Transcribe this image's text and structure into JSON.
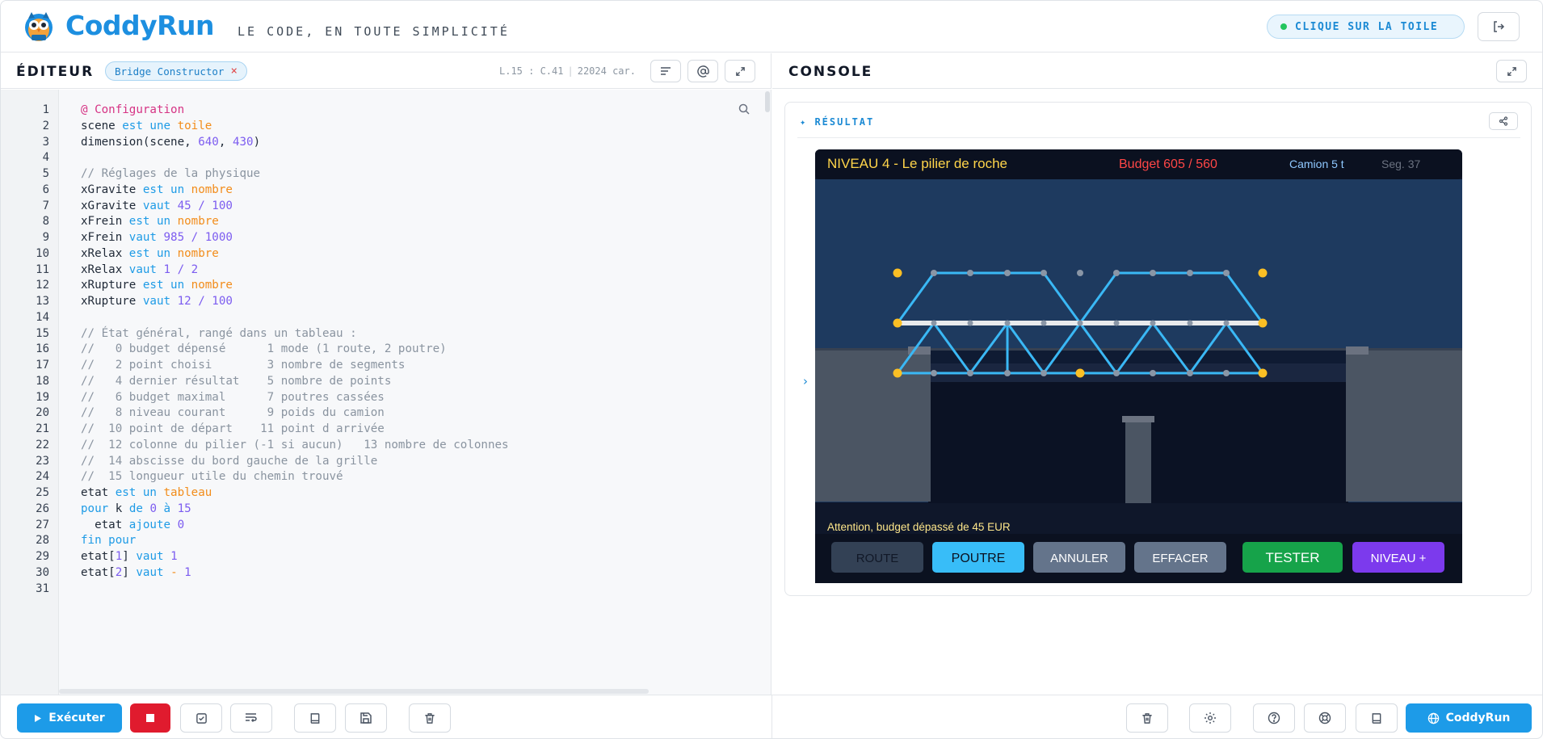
{
  "header": {
    "brand": "CoddyRun",
    "tagline": "LE CODE, EN TOUTE SIMPLICITÉ",
    "status_pill": "CLIQUE SUR LA TOILE",
    "colors": {
      "brand": "#1d8fe0",
      "accent": "#1d9be8",
      "status_dot": "#22c55e"
    }
  },
  "editor": {
    "title": "ÉDITEUR",
    "file_tag": "Bridge Constructor",
    "file_tag_close": "×",
    "cursor_pos": "L.15 : C.41",
    "char_count": "22024 car.",
    "lines": [
      {
        "n": "1",
        "t": [
          [
            "@ Configuration",
            "at"
          ]
        ]
      },
      {
        "n": "2",
        "t": [
          [
            "scene ",
            ""
          ],
          [
            "est une ",
            "kw"
          ],
          [
            "toile",
            "ty"
          ]
        ]
      },
      {
        "n": "3",
        "t": [
          [
            "dimension(scene, ",
            ""
          ],
          [
            "640",
            "num"
          ],
          [
            ", ",
            ""
          ],
          [
            "430",
            "num"
          ],
          [
            ")",
            ""
          ]
        ]
      },
      {
        "n": "4",
        "t": []
      },
      {
        "n": "5",
        "t": [
          [
            "// Réglages de la physique",
            "cm"
          ]
        ]
      },
      {
        "n": "6",
        "t": [
          [
            "xGravite ",
            ""
          ],
          [
            "est un ",
            "kw"
          ],
          [
            "nombre",
            "ty"
          ]
        ]
      },
      {
        "n": "7",
        "t": [
          [
            "xGravite ",
            ""
          ],
          [
            "vaut ",
            "kw"
          ],
          [
            "45 / 100",
            "num"
          ]
        ]
      },
      {
        "n": "8",
        "t": [
          [
            "xFrein ",
            ""
          ],
          [
            "est un ",
            "kw"
          ],
          [
            "nombre",
            "ty"
          ]
        ]
      },
      {
        "n": "9",
        "t": [
          [
            "xFrein ",
            ""
          ],
          [
            "vaut ",
            "kw"
          ],
          [
            "985 / 1000",
            "num"
          ]
        ]
      },
      {
        "n": "10",
        "t": [
          [
            "xRelax ",
            ""
          ],
          [
            "est un ",
            "kw"
          ],
          [
            "nombre",
            "ty"
          ]
        ]
      },
      {
        "n": "11",
        "t": [
          [
            "xRelax ",
            ""
          ],
          [
            "vaut ",
            "kw"
          ],
          [
            "1 / 2",
            "num"
          ]
        ]
      },
      {
        "n": "12",
        "t": [
          [
            "xRupture ",
            ""
          ],
          [
            "est un ",
            "kw"
          ],
          [
            "nombre",
            "ty"
          ]
        ]
      },
      {
        "n": "13",
        "t": [
          [
            "xRupture ",
            ""
          ],
          [
            "vaut ",
            "kw"
          ],
          [
            "12 / 100",
            "num"
          ]
        ]
      },
      {
        "n": "14",
        "t": []
      },
      {
        "n": "15",
        "t": [
          [
            "// État général, rangé dans un tableau :",
            "cm"
          ]
        ]
      },
      {
        "n": "16",
        "t": [
          [
            "//   0 budget dépensé      1 mode (1 route, 2 poutre)",
            "cm"
          ]
        ]
      },
      {
        "n": "17",
        "t": [
          [
            "//   2 point choisi        3 nombre de segments",
            "cm"
          ]
        ]
      },
      {
        "n": "18",
        "t": [
          [
            "//   4 dernier résultat    5 nombre de points",
            "cm"
          ]
        ]
      },
      {
        "n": "19",
        "t": [
          [
            "//   6 budget maximal      7 poutres cassées",
            "cm"
          ]
        ]
      },
      {
        "n": "20",
        "t": [
          [
            "//   8 niveau courant      9 poids du camion",
            "cm"
          ]
        ]
      },
      {
        "n": "21",
        "t": [
          [
            "//  10 point de départ    11 point d arrivée",
            "cm"
          ]
        ]
      },
      {
        "n": "22",
        "t": [
          [
            "//  12 colonne du pilier (-1 si aucun)   13 nombre de colonnes",
            "cm"
          ]
        ]
      },
      {
        "n": "23",
        "t": [
          [
            "//  14 abscisse du bord gauche de la grille",
            "cm"
          ]
        ]
      },
      {
        "n": "24",
        "t": [
          [
            "//  15 longueur utile du chemin trouvé",
            "cm"
          ]
        ]
      },
      {
        "n": "25",
        "t": [
          [
            "etat ",
            ""
          ],
          [
            "est un ",
            "kw"
          ],
          [
            "tableau",
            "ty"
          ]
        ]
      },
      {
        "n": "26",
        "t": [
          [
            "pour ",
            "kw"
          ],
          [
            "k ",
            ""
          ],
          [
            "de ",
            "kw"
          ],
          [
            "0 ",
            "num"
          ],
          [
            "à ",
            "kw"
          ],
          [
            "15",
            "num"
          ]
        ]
      },
      {
        "n": "27",
        "t": [
          [
            "  etat ",
            ""
          ],
          [
            "ajoute ",
            "kw"
          ],
          [
            "0",
            "num"
          ]
        ]
      },
      {
        "n": "28",
        "t": [
          [
            "fin pour",
            "kw"
          ]
        ]
      },
      {
        "n": "29",
        "t": [
          [
            "etat[",
            ""
          ],
          [
            "1",
            "num"
          ],
          [
            "] ",
            ""
          ],
          [
            "vaut ",
            "kw"
          ],
          [
            "1",
            "num"
          ]
        ]
      },
      {
        "n": "30",
        "t": [
          [
            "etat[",
            ""
          ],
          [
            "2",
            "num"
          ],
          [
            "] ",
            ""
          ],
          [
            "vaut ",
            "kw"
          ],
          [
            "- ",
            "ty"
          ],
          [
            "1",
            "num"
          ]
        ]
      },
      {
        "n": "31",
        "t": []
      }
    ]
  },
  "console": {
    "title": "CONSOLE",
    "result_label": "✦ RÉSULTAT",
    "chevron": "›"
  },
  "game": {
    "level_title": "NIVEAU 4 - Le pilier de roche",
    "budget": "Budget 605 / 560",
    "truck": "Camion 5 t",
    "segments": "Seg. 37",
    "warning": "Attention, budget dépassé de 45 EUR",
    "buttons": [
      "ROUTE",
      "POUTRE",
      "ANNULER",
      "EFFACER",
      "TESTER",
      "NIVEAU +"
    ],
    "colors": {
      "title": "#ffd54a",
      "budget": "#ff4646",
      "truck": "#8fc8ff",
      "beam": "#3ab8f5",
      "road": "#e8eaec",
      "anchor": "#fbbf24",
      "node": "#8a96a6"
    }
  },
  "footer": {
    "run_label": "Exécuter",
    "coddy_label": "CoddyRun"
  }
}
